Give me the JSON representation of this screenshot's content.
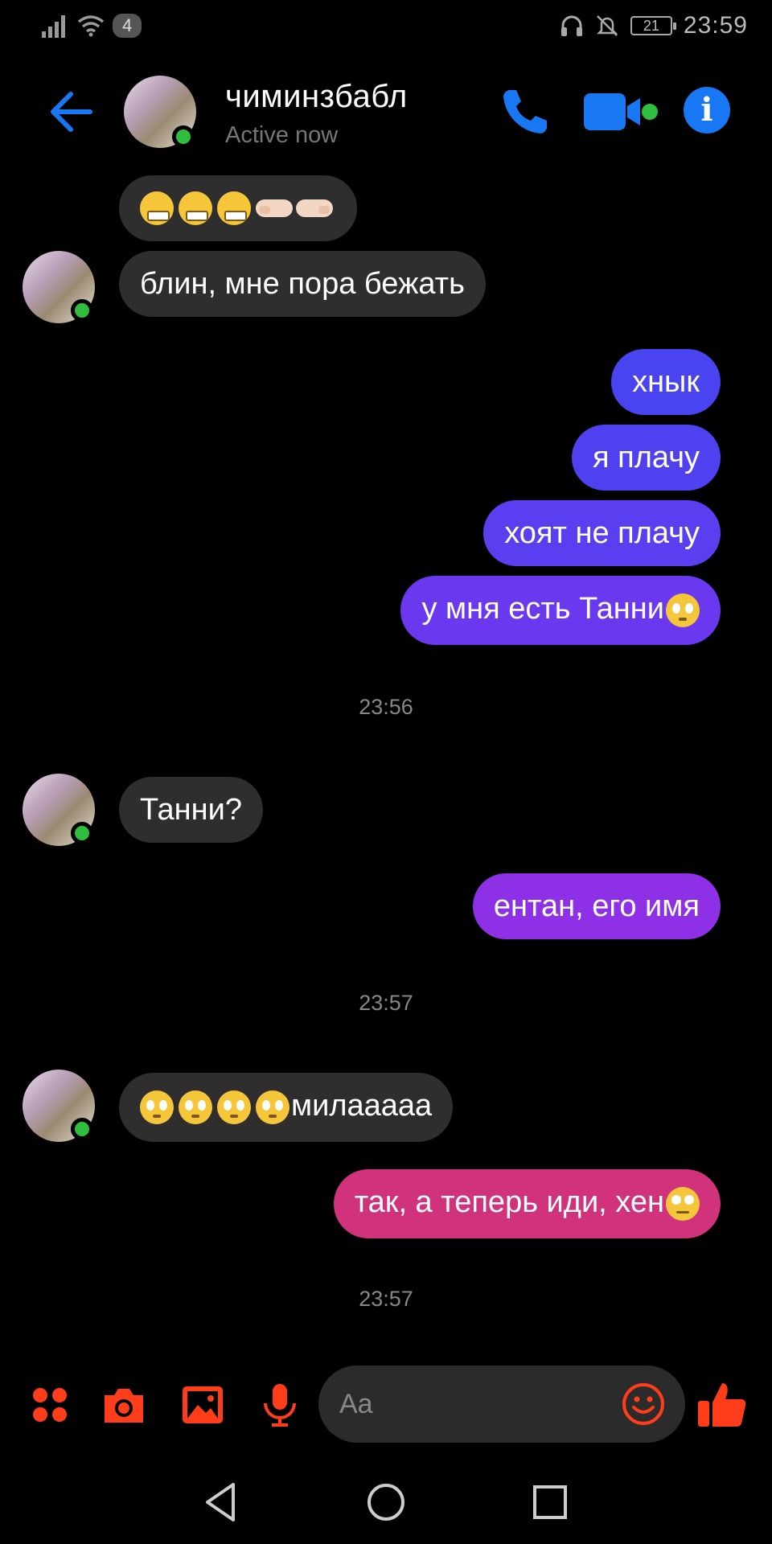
{
  "status_bar": {
    "notification_count": "4",
    "battery": "21",
    "time": "23:59",
    "icons": [
      "signal-icon",
      "wifi-icon",
      "headphones-icon",
      "muted-bell-icon",
      "battery-icon"
    ]
  },
  "header": {
    "contact_name": "чиминзбабл",
    "status": "Active now",
    "icons": [
      "back-arrow-icon",
      "phone-icon",
      "video-camera-icon",
      "info-icon"
    ]
  },
  "messages": [
    {
      "side": "in",
      "text": "",
      "emoji": [
        "grimace",
        "grimace",
        "grimace",
        "point-right",
        "point-left"
      ]
    },
    {
      "side": "in",
      "text": "блин, мне пора бежать"
    },
    {
      "side": "out",
      "text": "хнык"
    },
    {
      "side": "out",
      "text": "я плачу"
    },
    {
      "side": "out",
      "text": "хоят не плачу"
    },
    {
      "side": "out",
      "text": "у мня есть Танни",
      "emoji_after": "pleading"
    },
    {
      "side": "in",
      "text": "Танни?"
    },
    {
      "side": "out",
      "text": "ентан, его имя"
    },
    {
      "side": "in",
      "text": "милааааа",
      "emoji_before": [
        "pleading",
        "pleading",
        "pleading",
        "pleading"
      ]
    },
    {
      "side": "out",
      "text": "так, а теперь иди, хен",
      "emoji_after": "eye-roll"
    }
  ],
  "timestamps": [
    "23:56",
    "23:57",
    "23:57"
  ],
  "colors": {
    "incoming_bubble": "#2e2e2e",
    "outgoing_blue": "#4a44f0",
    "outgoing_violet": "#6a38ef",
    "outgoing_purple": "#8e30e6",
    "outgoing_pink": "#d0327c",
    "accent_blue": "#1877f2",
    "composer_accent": "#ff3d1a",
    "online_green": "#2fbe3d"
  },
  "composer": {
    "placeholder": "Aa",
    "icons": [
      "apps-grid-icon",
      "camera-icon",
      "gallery-icon",
      "microphone-icon",
      "emoji-icon",
      "thumbs-up-icon"
    ]
  },
  "navigation": {
    "icons": [
      "back-triangle-icon",
      "home-circle-icon",
      "recents-square-icon"
    ]
  }
}
